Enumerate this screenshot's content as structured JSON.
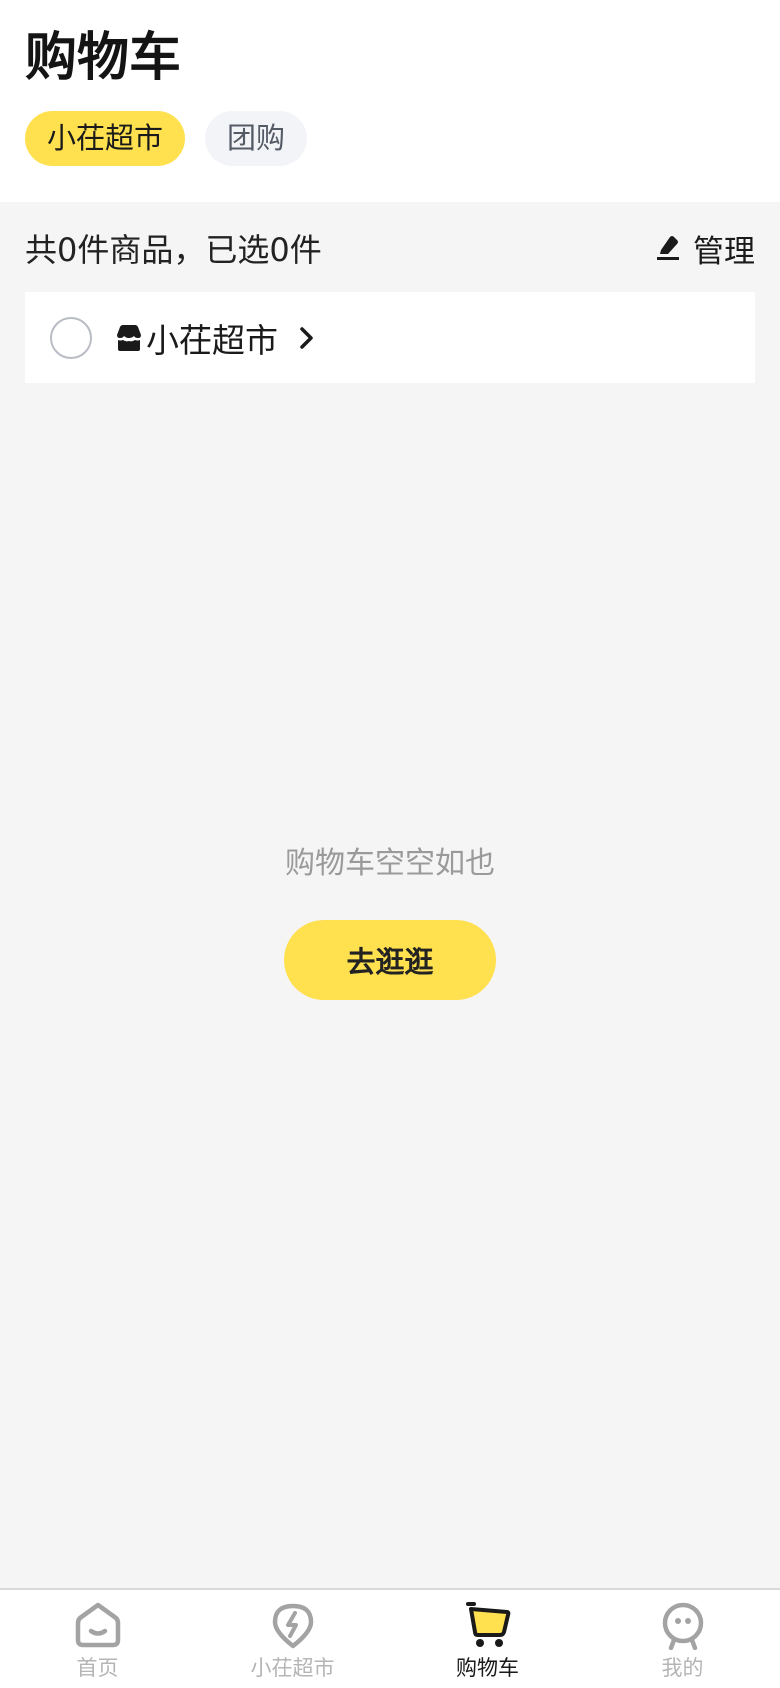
{
  "header": {
    "title": "购物车",
    "tabs": [
      {
        "label": "小茌超市",
        "active": true
      },
      {
        "label": "团购",
        "active": false
      }
    ]
  },
  "summary": {
    "text": "共0件商品，已选0件",
    "manage_label": "管理"
  },
  "store": {
    "name": "小茌超市"
  },
  "empty": {
    "message": "购物车空空如也",
    "button_label": "去逛逛"
  },
  "tabbar": {
    "items": [
      {
        "label": "首页",
        "icon": "home-face-icon"
      },
      {
        "label": "小茌超市",
        "icon": "lightning-pin-icon"
      },
      {
        "label": "购物车",
        "icon": "cart-icon",
        "current": true
      },
      {
        "label": "我的",
        "icon": "profile-face-icon"
      }
    ]
  },
  "colors": {
    "accent": "#ffe04f",
    "background": "#f5f5f5",
    "muted_text": "#9a9a9a"
  }
}
